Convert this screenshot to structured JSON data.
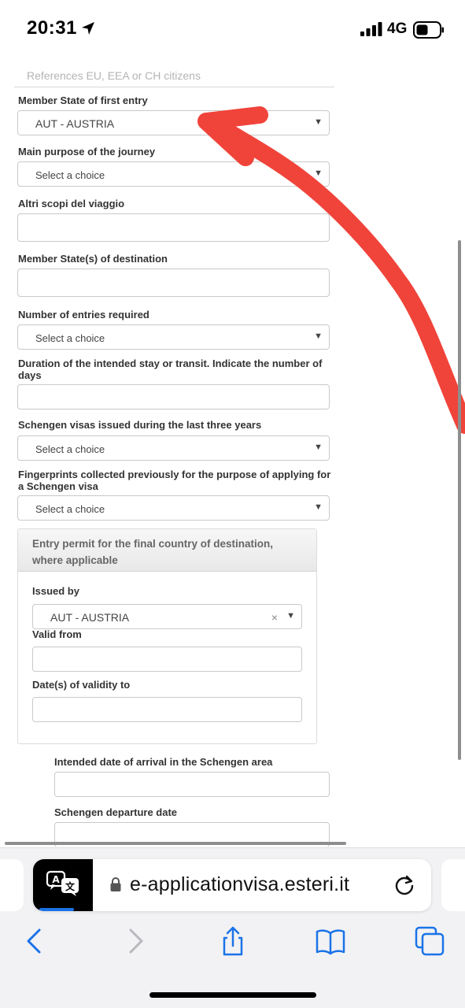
{
  "status_bar": {
    "time": "20:31",
    "network": "4G"
  },
  "form": {
    "reference_text": "References EU, EEA or CH citizens",
    "member_state_first_entry": {
      "label": "Member State of first entry",
      "value": "AUT - AUSTRIA"
    },
    "main_purpose": {
      "label": "Main purpose of the journey",
      "value": "Select a choice"
    },
    "other_purposes": {
      "label": "Altri scopi del viaggio",
      "value": ""
    },
    "member_states_destination": {
      "label": "Member State(s) of destination",
      "value": ""
    },
    "entries_required": {
      "label": "Number of entries required",
      "value": "Select a choice"
    },
    "duration_stay": {
      "label": "Duration of the intended stay or transit. Indicate the number of days",
      "value": ""
    },
    "schengen_visas": {
      "label": "Schengen visas issued during the last three years",
      "value": "Select a choice"
    },
    "fingerprints": {
      "label": "Fingerprints collected previously for the purpose of applying for a Schengen visa",
      "value": "Select a choice"
    },
    "entry_permit_panel": {
      "title": "Entry permit for the final country of destination, where applicable",
      "issued_by": {
        "label": "Issued by",
        "value": "AUT - AUSTRIA"
      },
      "valid_from": {
        "label": "Valid from",
        "value": ""
      },
      "validity_to": {
        "label": "Date(s) of validity to",
        "value": ""
      }
    },
    "arrival_date": {
      "label": "Intended date of arrival in the Schengen area",
      "value": ""
    },
    "departure_date": {
      "label": "Schengen departure date",
      "value": ""
    }
  },
  "safari": {
    "url": "e-applicationvisa.esteri.it",
    "icons": [
      "translate-icon",
      "lock-icon",
      "reload-icon",
      "back-icon",
      "forward-icon",
      "share-icon",
      "bookmarks-icon",
      "tabs-icon"
    ]
  },
  "colors": {
    "annotation_arrow": "#f0443a",
    "safari_blue": "#1a73e8"
  }
}
